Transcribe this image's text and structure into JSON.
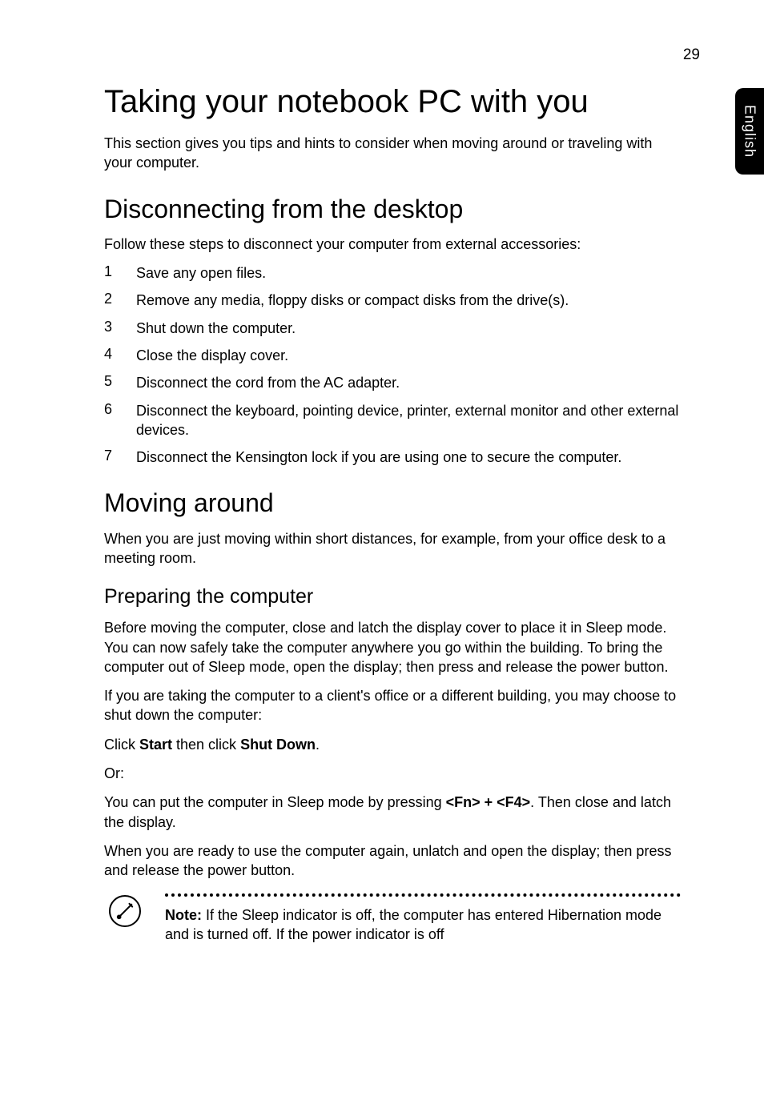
{
  "page_number": "29",
  "side_tab": "English",
  "title": "Taking your notebook PC with you",
  "intro": "This section gives you tips and hints to consider when moving around or traveling with your computer.",
  "section1": {
    "heading": "Disconnecting from the desktop",
    "lead": "Follow these steps to disconnect your computer from external accessories:",
    "items": [
      "Save any open files.",
      "Remove any media, floppy disks or compact disks from the drive(s).",
      "Shut down the computer.",
      "Close the display cover.",
      "Disconnect the cord from the AC adapter.",
      "Disconnect the keyboard, pointing device, printer, external monitor and other external devices.",
      "Disconnect the Kensington lock if you are using one to secure the computer."
    ]
  },
  "section2": {
    "heading": "Moving around",
    "lead": "When you are just moving within short distances, for example, from your office desk to a meeting room.",
    "sub1": {
      "heading": "Preparing the computer",
      "p1": "Before moving the computer, close and latch the display cover to place it in Sleep mode. You can now safely take the computer anywhere you go within the building. To bring the computer out of Sleep mode, open the display; then press and release the power button.",
      "p2": "If you are taking the computer to a client's office or a different building, you may choose to shut down the computer:",
      "p3_pre": "Click ",
      "p3_b1": "Start",
      "p3_mid": " then click ",
      "p3_b2": "Shut Down",
      "p3_post": ".",
      "p4": "Or:",
      "p5_pre": "You can put the computer in Sleep mode by pressing ",
      "p5_b1": "<Fn> + <F4>",
      "p5_post": ". Then close and latch the display.",
      "p6": "When you are ready to use the computer again, unlatch and open the display; then press and release the power button.",
      "note_label": "Note:",
      "note_body": " If the Sleep indicator is off, the computer has entered Hibernation mode and is turned off. If the power indicator is off"
    }
  }
}
